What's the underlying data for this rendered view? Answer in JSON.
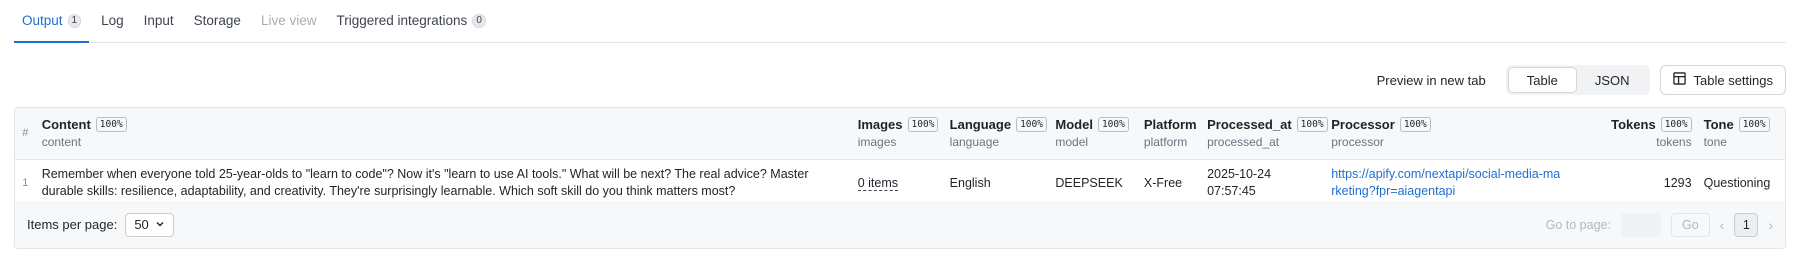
{
  "tabs": [
    {
      "label": "Output",
      "badge": "1"
    },
    {
      "label": "Log"
    },
    {
      "label": "Input"
    },
    {
      "label": "Storage"
    },
    {
      "label": "Live view"
    },
    {
      "label": "Triggered integrations",
      "badge": "0"
    }
  ],
  "toolbar": {
    "preview_label": "Preview in new tab",
    "view_table": "Table",
    "view_json": "JSON",
    "settings_label": "Table settings"
  },
  "table": {
    "index_header": "#",
    "columns": [
      {
        "label": "Content",
        "pct": "100%",
        "sub": "content"
      },
      {
        "label": "Images",
        "pct": "100%",
        "sub": "images"
      },
      {
        "label": "Language",
        "pct": "100%",
        "sub": "language"
      },
      {
        "label": "Model",
        "pct": "100%",
        "sub": "model"
      },
      {
        "label": "Platform",
        "sub": "platform"
      },
      {
        "label": "Processed_at",
        "pct": "100%",
        "sub": "processed_at"
      },
      {
        "label": "Processor",
        "pct": "100%",
        "sub": "processor"
      },
      {
        "label": "Tokens",
        "pct": "100%",
        "sub": "tokens"
      },
      {
        "label": "Tone",
        "pct": "100%",
        "sub": "tone"
      }
    ],
    "rows": [
      {
        "index": "1",
        "content": "Remember when everyone told 25-year-olds to \"learn to code\"? Now it's \"learn to use AI tools.\" What will be next? The real advice? Master durable skills: resilience, adaptability, and creativity. They're surprisingly learnable. Which soft skill do you think matters most?",
        "images": "0 items",
        "language": "English",
        "model": "DEEPSEEK",
        "platform": "X-Free",
        "processed_at": "2025-10-24 07:57:45",
        "processor": "https://apify.com/nextapi/social-media-marketing?fpr=aiagentapi",
        "tokens": "1293",
        "tone": "Questioning"
      }
    ]
  },
  "footer": {
    "items_per_page_label": "Items per page:",
    "items_per_page_value": "50",
    "goto_label": "Go to page:",
    "go_label": "Go",
    "current_page": "1"
  }
}
